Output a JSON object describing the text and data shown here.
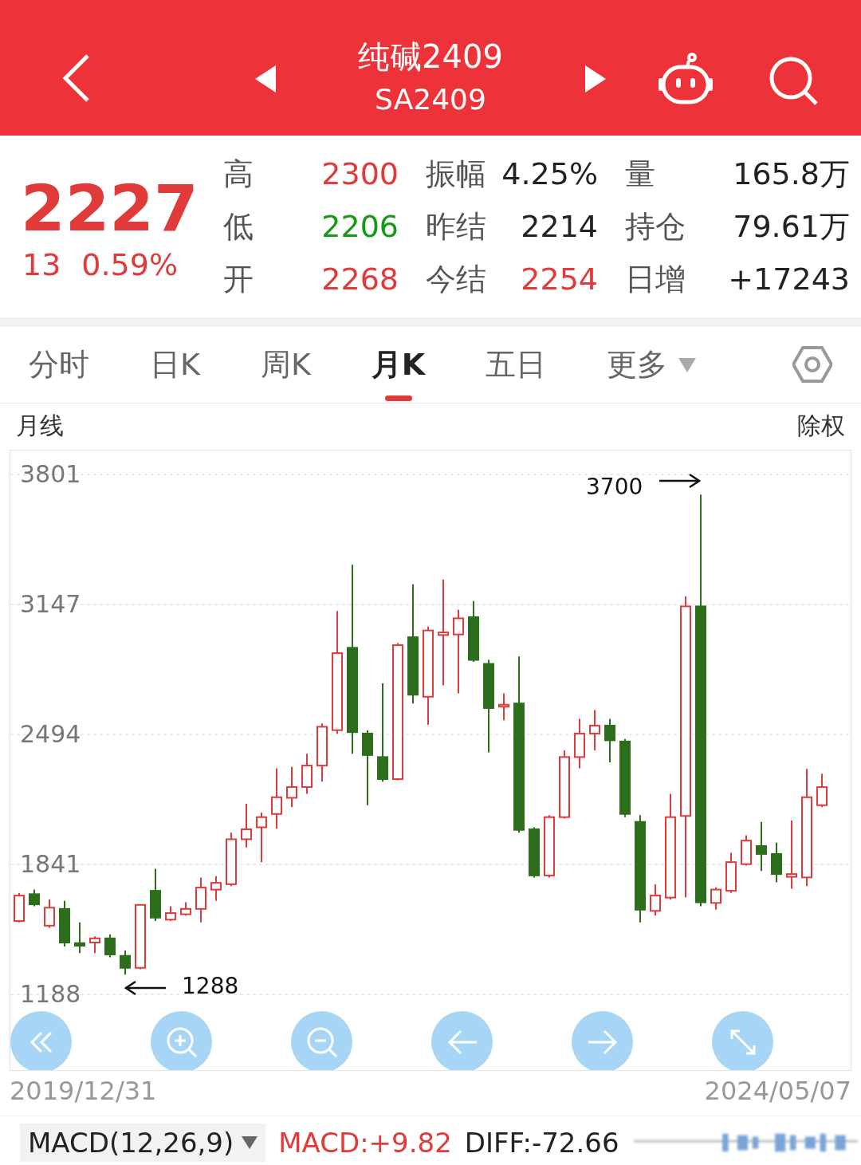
{
  "header": {
    "title": "纯碱2409",
    "code": "SA2409"
  },
  "quote": {
    "price": "2227",
    "change": "13",
    "change_pct": "0.59%",
    "stats": [
      {
        "label": "高",
        "value": "2300",
        "color": "#e03a3a"
      },
      {
        "label": "振幅",
        "value": "4.25%",
        "color": "#222222"
      },
      {
        "label": "量",
        "value": "165.8万",
        "color": "#222222"
      },
      {
        "label": "低",
        "value": "2206",
        "color": "#159a15"
      },
      {
        "label": "昨结",
        "value": "2214",
        "color": "#222222"
      },
      {
        "label": "持仓",
        "value": "79.61万",
        "color": "#222222"
      },
      {
        "label": "开",
        "value": "2268",
        "color": "#e03a3a"
      },
      {
        "label": "今结",
        "value": "2254",
        "color": "#e03a3a"
      },
      {
        "label": "日增",
        "value": "+17243",
        "color": "#222222"
      }
    ]
  },
  "tabs": [
    {
      "label": "分时",
      "selected": false,
      "kind": "plain"
    },
    {
      "label": "日K",
      "selected": false,
      "kind": "plain"
    },
    {
      "label": "周K",
      "selected": false,
      "kind": "plain"
    },
    {
      "label": "月K",
      "selected": true,
      "kind": "plain"
    },
    {
      "label": "五日",
      "selected": false,
      "kind": "plain"
    },
    {
      "label": "更多",
      "selected": false,
      "kind": "menu"
    }
  ],
  "chart": {
    "period": "月线",
    "adjust": "除权",
    "start_date": "2019/12/31",
    "end_date": "2024/05/07",
    "chart_data": {
      "type": "candlestick",
      "ylim": [
        808,
        3921
      ],
      "yticks": [
        3801,
        3147,
        2494,
        1841,
        1188
      ],
      "ohlc": [
        [
          1557,
          1698,
          1550,
          1685
        ],
        [
          1692,
          1715,
          1631,
          1641
        ],
        [
          1534,
          1665,
          1523,
          1624
        ],
        [
          1618,
          1658,
          1429,
          1449
        ],
        [
          1446,
          1550,
          1396,
          1433
        ],
        [
          1449,
          1480,
          1396,
          1470
        ],
        [
          1470,
          1490,
          1375,
          1389
        ],
        [
          1382,
          1409,
          1288,
          1322
        ],
        [
          1322,
          1641,
          1315,
          1638
        ],
        [
          1709,
          1820,
          1557,
          1574
        ],
        [
          1564,
          1631,
          1557,
          1597
        ],
        [
          1591,
          1651,
          1584,
          1618
        ],
        [
          1618,
          1776,
          1550,
          1725
        ],
        [
          1715,
          1783,
          1658,
          1749
        ],
        [
          1742,
          2001,
          1732,
          1968
        ],
        [
          1968,
          2146,
          1927,
          2018
        ],
        [
          2028,
          2102,
          1853,
          2079
        ],
        [
          2095,
          2324,
          2021,
          2179
        ],
        [
          2176,
          2331,
          2129,
          2230
        ],
        [
          2230,
          2398,
          2196,
          2338
        ],
        [
          2338,
          2550,
          2257,
          2533
        ],
        [
          2516,
          3115,
          2499,
          2903
        ],
        [
          2930,
          3347,
          2398,
          2506
        ],
        [
          2499,
          2516,
          2139,
          2391
        ],
        [
          2381,
          2751,
          2257,
          2270
        ],
        [
          2270,
          2953,
          2264,
          2943
        ],
        [
          2983,
          3249,
          2650,
          2694
        ],
        [
          2684,
          3037,
          2543,
          3017
        ],
        [
          2994,
          3273,
          2741,
          3007
        ],
        [
          2997,
          3121,
          2701,
          3078
        ],
        [
          3084,
          3165,
          2859,
          2869
        ],
        [
          2849,
          2869,
          2405,
          2627
        ],
        [
          2634,
          2701,
          2566,
          2644
        ],
        [
          2650,
          2886,
          2001,
          2015
        ],
        [
          2018,
          2028,
          1776,
          1786
        ],
        [
          1786,
          2089,
          1776,
          2079
        ],
        [
          2079,
          2415,
          2072,
          2381
        ],
        [
          2381,
          2573,
          2324,
          2499
        ],
        [
          2499,
          2617,
          2415,
          2539
        ],
        [
          2539,
          2573,
          2354,
          2465
        ],
        [
          2459,
          2472,
          2079,
          2095
        ],
        [
          2055,
          2089,
          1550,
          1614
        ],
        [
          1608,
          1742,
          1584,
          1685
        ],
        [
          1675,
          2196,
          1665,
          2079
        ],
        [
          2085,
          3189,
          1675,
          3138
        ],
        [
          3138,
          3700,
          1631,
          1651
        ],
        [
          1648,
          1725,
          1614,
          1715
        ],
        [
          1709,
          1900,
          1698,
          1853
        ],
        [
          1843,
          1988,
          1836,
          1961
        ],
        [
          1934,
          2055,
          1809,
          1894
        ],
        [
          1894,
          1951,
          1752,
          1793
        ],
        [
          1779,
          2062,
          1719,
          1793
        ],
        [
          1776,
          2321,
          1732,
          2179
        ],
        [
          2139,
          2297,
          2129,
          2230
        ]
      ],
      "grid": true,
      "annotations": [
        "3700",
        "1288"
      ]
    }
  },
  "indicator": {
    "name": "MACD(12,26,9)",
    "values": [
      {
        "text": "MACD:+9.82",
        "color": "#e03a3a"
      },
      {
        "text": "DIFF:-72.66",
        "color": "#222222"
      }
    ]
  }
}
